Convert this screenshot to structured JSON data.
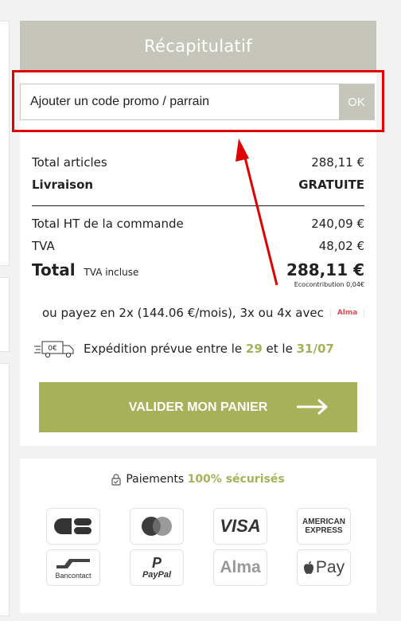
{
  "summary": {
    "title": "Récapitulatif",
    "promo": {
      "placeholder": "Ajouter un code promo / parrain",
      "ok_label": "OK"
    },
    "rows": {
      "total_articles_label": "Total articles",
      "total_articles_value": "288,11 €",
      "delivery_label": "Livraison",
      "delivery_value": "GRATUITE",
      "total_ht_label": "Total HT de la commande",
      "total_ht_value": "240,09 €",
      "tva_label": "TVA",
      "tva_value": "48,02 €",
      "total_label": "Total",
      "total_sub": "TVA incluse",
      "total_value": "288,11 €",
      "eco": "Ecocontribution 0,04€"
    },
    "alma_text": "ou payez en 2x (144.06 €/mois), 3x ou 4x avec",
    "alma_badge": "Alma",
    "shipping": {
      "truck_label": "0€",
      "text_prefix": "Expédition prévue entre le",
      "date1": "29",
      "middle": "et le",
      "date2": "31/07"
    },
    "validate_label": "VALIDER MON PANIER"
  },
  "payments": {
    "title_prefix": "Paiements",
    "title_highlight": "100% sécurisés",
    "methods": [
      "CB",
      "Mastercard",
      "VISA",
      "American Express",
      "Bancontact",
      "PayPal",
      "Alma",
      "Apple Pay"
    ],
    "card_texts": {
      "visa": "VISA",
      "amex_line1": "AMERICAN",
      "amex_line2": "EXPRESS",
      "bancontact": "Bancontact",
      "paypal": "PayPal",
      "alma": "Alma",
      "apple_pay": "Pay"
    }
  },
  "colors": {
    "accent_green": "#a7b15a",
    "header_grey": "#c5c6b9",
    "highlight_red": "#e00000"
  }
}
